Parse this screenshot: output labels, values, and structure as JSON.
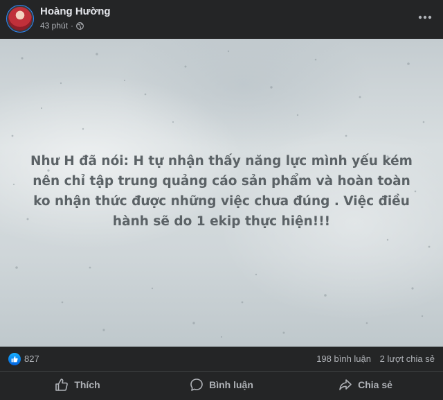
{
  "post": {
    "author": "Hoàng Hường",
    "time": "43 phút",
    "separator": "·",
    "privacy_icon": "globe-icon",
    "menu_icon": "more-horizontal-icon"
  },
  "image_text": {
    "line1": "Như H đã nói: H tự nhận thấy năng lực mình yếu kém",
    "line2": "nên chỉ tập trung quảng cáo sản phẩm và hoàn toàn",
    "line3": "ko nhận thức được những việc chưa đúng . Việc điều",
    "line4": "hành sẽ do 1 ekip thực hiện!!!"
  },
  "stats": {
    "reaction_icon": "like-reaction-icon",
    "reactions": "827",
    "comments": "198 bình luận",
    "shares": "2 lượt chia sẻ"
  },
  "actions": {
    "like": "Thích",
    "comment": "Bình luận",
    "share": "Chia sẻ"
  },
  "colors": {
    "background": "#242526",
    "text_primary": "#e4e6eb",
    "text_secondary": "#b0b3b8",
    "like_blue": "#0866ff",
    "image_text": "#5b6266"
  }
}
